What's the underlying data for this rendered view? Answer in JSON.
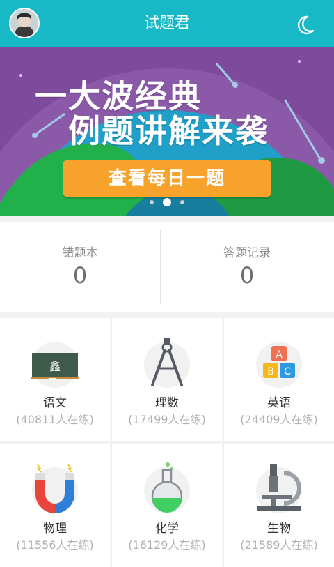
{
  "header": {
    "title": "试题君",
    "avatar_icon": "user-avatar",
    "theme_icon": "moon-icon"
  },
  "banner": {
    "line1": "一大波经典",
    "line2": "例题讲解来袭",
    "cta_label": "查看每日一题",
    "page_count": 3,
    "active_page": 2
  },
  "stats": [
    {
      "label": "错题本",
      "value": "0"
    },
    {
      "label": "答题记录",
      "value": "0"
    }
  ],
  "subjects": [
    {
      "name": "语文",
      "practicing": "(40811人在练)",
      "icon": "chalkboard-icon",
      "board_char": "鑫"
    },
    {
      "name": "理数",
      "practicing": "(17499人在练)",
      "icon": "compass-icon"
    },
    {
      "name": "英语",
      "practicing": "(24409人在练)",
      "icon": "abc-blocks-icon",
      "letters": [
        "A",
        "B",
        "C"
      ]
    },
    {
      "name": "物理",
      "practicing": "(11556人在练)",
      "icon": "magnet-icon"
    },
    {
      "name": "化学",
      "practicing": "(16129人在练)",
      "icon": "flask-icon"
    },
    {
      "name": "生物",
      "practicing": "(21589人在练)",
      "icon": "microscope-icon"
    }
  ],
  "colors": {
    "primary": "#18b9c6",
    "banner_bg": "#7e4b9c",
    "cta": "#f6a22b"
  }
}
